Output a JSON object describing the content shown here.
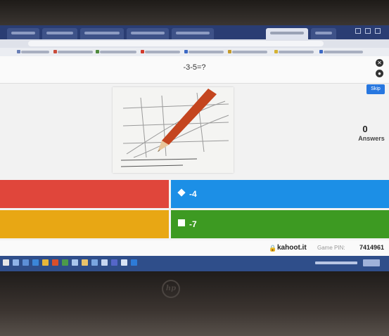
{
  "question": {
    "text": "-3-5=?"
  },
  "header_buttons": {
    "close_glyph": "✕",
    "fullscreen_glyph": "●"
  },
  "skip": {
    "label": "Skip"
  },
  "stats": {
    "answers_count": "0",
    "answers_label": "Answers"
  },
  "answers": [
    {
      "label": "",
      "shape": "triangle-icon",
      "color": "#e0463b"
    },
    {
      "label": "-4",
      "shape": "diamond-icon",
      "color": "#1c8fe6"
    },
    {
      "label": "",
      "shape": "circle-icon",
      "color": "#e8a714"
    },
    {
      "label": "-7",
      "shape": "square-icon",
      "color": "#3d9a22"
    }
  ],
  "footer": {
    "brand": "kahoot.it",
    "pin_label": "Game PIN:",
    "pin_value": "7414961"
  },
  "colors": {
    "browser_chrome": "#2a3d73",
    "taskbar": "#2f4e8a",
    "skip_blue": "#2777e0"
  }
}
